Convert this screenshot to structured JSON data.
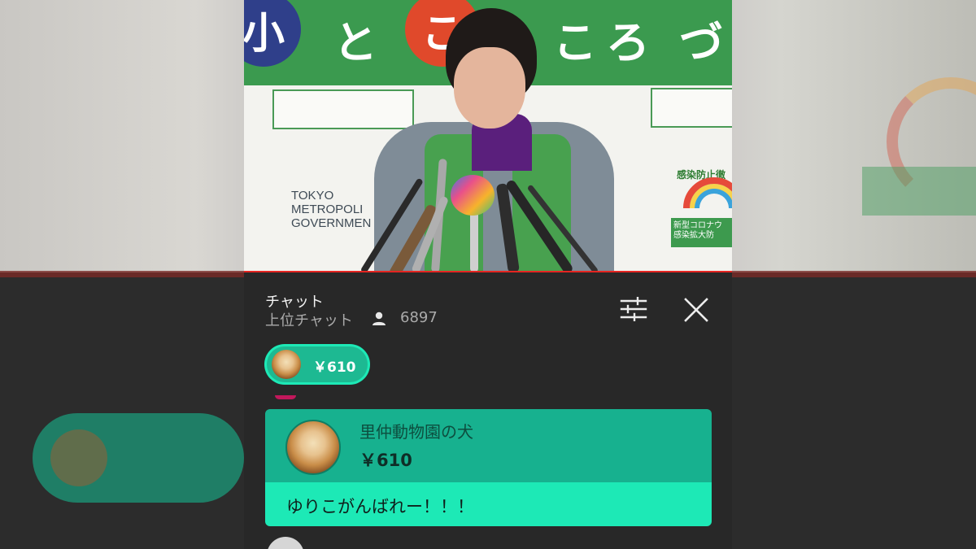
{
  "chat": {
    "title": "チャット",
    "mode": "上位チャット",
    "viewer_count": "6897",
    "viewer_icon": "person-icon",
    "filter_icon": "tune-icon",
    "close_icon": "close-icon"
  },
  "ticker": {
    "amount": "￥610"
  },
  "superchat": {
    "author": "里仲動物園の犬",
    "amount": "￥610",
    "message": "ゆりこがんばれー！！！",
    "colors": {
      "header": "#17b18f",
      "body": "#1de9b6"
    }
  },
  "video": {
    "banner_chars": [
      "小",
      "と",
      "こ",
      "こ",
      "ろ",
      "づ"
    ],
    "sign_lines": [
      "TOKYO",
      "METROPOLI",
      "GOVERNMEN"
    ],
    "poster_text": "感染防止徹",
    "badge_text": "新型コロナウ\n感染拡大防",
    "brand_green": "#3b9a4f",
    "live_bar_color": "#e52521"
  }
}
